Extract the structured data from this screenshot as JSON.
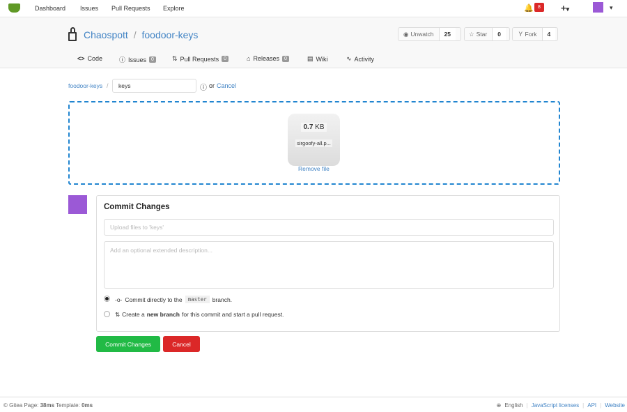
{
  "nav": {
    "items": [
      "Dashboard",
      "Issues",
      "Pull Requests",
      "Explore"
    ],
    "notification_count": "8",
    "plus": "+",
    "caret": "▾"
  },
  "repo": {
    "owner": "Chaospott",
    "separator": "/",
    "name": "foodoor-keys",
    "watch_label": "Unwatch",
    "watch_count": "25",
    "star_label": "Star",
    "star_count": "0",
    "fork_label": "Fork",
    "fork_count": "4"
  },
  "tabs": [
    {
      "label": "Code",
      "icon": "<>"
    },
    {
      "label": "Issues",
      "count": "0"
    },
    {
      "label": "Pull Requests",
      "count": "0"
    },
    {
      "label": "Releases",
      "count": "0"
    },
    {
      "label": "Wiki"
    },
    {
      "label": "Activity"
    }
  ],
  "path": {
    "repo": "foodoor-keys",
    "sep": "/",
    "dir_value": "keys",
    "or": "or",
    "cancel": "Cancel"
  },
  "upload": {
    "size_num": "0.7",
    "size_unit": "KB",
    "filename": "sirgoofy-all.p...",
    "remove": "Remove file"
  },
  "commit": {
    "title": "Commit Changes",
    "summary_placeholder": "Upload files to 'keys'",
    "desc_placeholder": "Add an optional extended description...",
    "opt1_pre": "Commit directly to the",
    "branch": "master",
    "opt1_post": "branch.",
    "opt2_pre": "Create a",
    "opt2_bold": "new branch",
    "opt2_post": "for this commit and start a pull request.",
    "submit": "Commit Changes",
    "cancel": "Cancel"
  },
  "footer": {
    "left_prefix": "© Gitea Page:",
    "page_time": "38ms",
    "template_label": "Template:",
    "template_time": "0ms",
    "language": "English",
    "links": [
      "JavaScript licenses",
      "API",
      "Website"
    ]
  },
  "colors": {
    "primary": "#21ba45",
    "danger": "#db2828",
    "link": "#4183c4",
    "avatar": "#9b59d6"
  }
}
